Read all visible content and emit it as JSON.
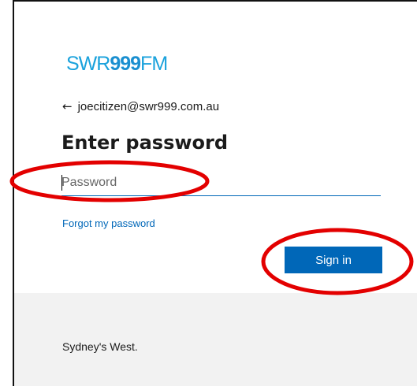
{
  "logo": {
    "text_prefix": "SWR",
    "text_bold": "999",
    "text_suffix": "FM"
  },
  "back": {
    "icon": "back-arrow-icon",
    "glyph": "←",
    "account": "joecitizen@swr999.com.au"
  },
  "heading": "Enter password",
  "password": {
    "placeholder": "Password",
    "value": ""
  },
  "forgot_link": "Forgot my password",
  "signin_button": "Sign in",
  "footer": {
    "text": "Sydney's West."
  },
  "colors": {
    "accent": "#0067b8",
    "logo": "#1aa2dc",
    "annotation": "#e30000",
    "footer_bg": "#f2f2f2"
  }
}
